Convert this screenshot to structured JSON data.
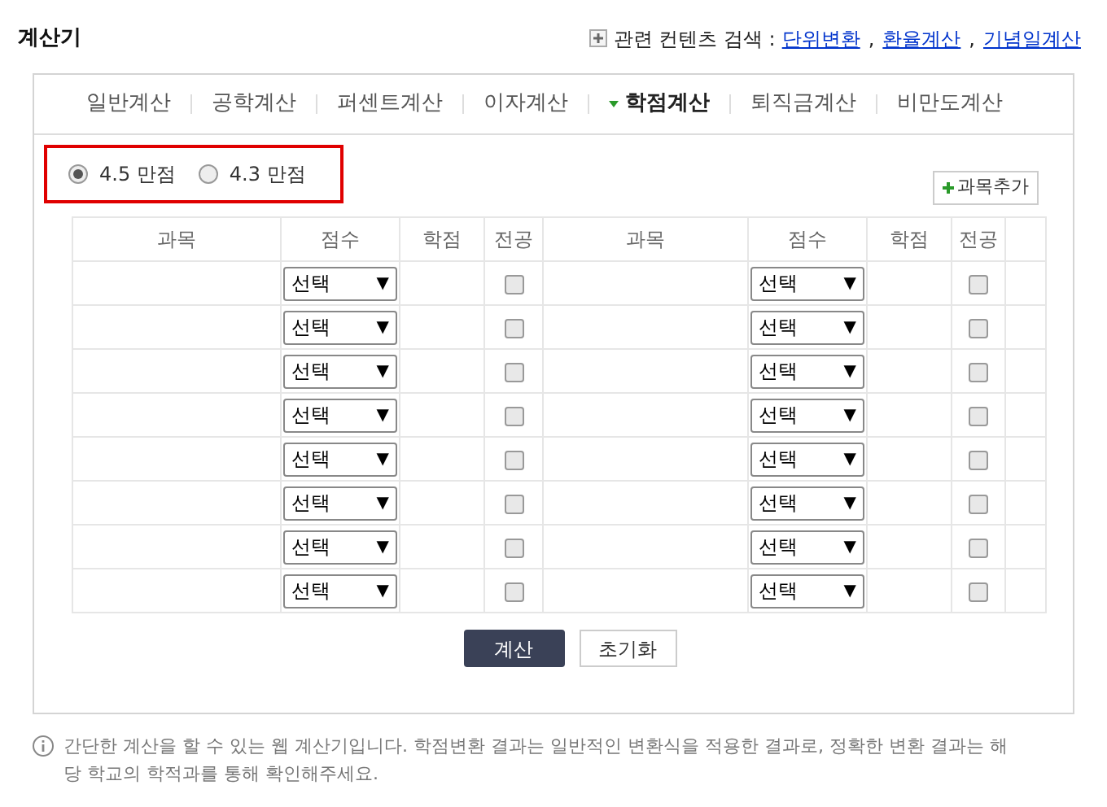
{
  "title": "계산기",
  "related": {
    "label": "관련 컨텐츠 검색 :",
    "links": [
      "단위변환",
      "환율계산",
      "기념일계산"
    ],
    "separator": ","
  },
  "tabs": [
    {
      "label": "일반계산",
      "selected": false
    },
    {
      "label": "공학계산",
      "selected": false
    },
    {
      "label": "퍼센트계산",
      "selected": false
    },
    {
      "label": "이자계산",
      "selected": false
    },
    {
      "label": "학점계산",
      "selected": true
    },
    {
      "label": "퇴직금계산",
      "selected": false
    },
    {
      "label": "비만도계산",
      "selected": false
    }
  ],
  "scale_options": [
    {
      "label": "4.5 만점",
      "selected": true
    },
    {
      "label": "4.3 만점",
      "selected": false
    }
  ],
  "add_subject_button": "과목추가",
  "table": {
    "columns": [
      "과목",
      "점수",
      "학점",
      "전공",
      "과목",
      "점수",
      "학점",
      "전공"
    ],
    "rows": [
      {
        "cells": [
          {
            "kind": "text",
            "text": ""
          },
          {
            "kind": "dropdown",
            "value": "선택"
          },
          {
            "kind": "text",
            "text": ""
          },
          {
            "kind": "checkbox",
            "checked": false
          },
          {
            "kind": "text",
            "text": ""
          },
          {
            "kind": "dropdown",
            "value": "선택"
          },
          {
            "kind": "text",
            "text": ""
          },
          {
            "kind": "checkbox",
            "checked": false
          }
        ]
      },
      {
        "cells": [
          {
            "kind": "text",
            "text": ""
          },
          {
            "kind": "dropdown",
            "value": "선택"
          },
          {
            "kind": "text",
            "text": ""
          },
          {
            "kind": "checkbox",
            "checked": false
          },
          {
            "kind": "text",
            "text": ""
          },
          {
            "kind": "dropdown",
            "value": "선택"
          },
          {
            "kind": "text",
            "text": ""
          },
          {
            "kind": "checkbox",
            "checked": false
          }
        ]
      },
      {
        "cells": [
          {
            "kind": "text",
            "text": ""
          },
          {
            "kind": "dropdown",
            "value": "선택"
          },
          {
            "kind": "text",
            "text": ""
          },
          {
            "kind": "checkbox",
            "checked": false
          },
          {
            "kind": "text",
            "text": ""
          },
          {
            "kind": "dropdown",
            "value": "선택"
          },
          {
            "kind": "text",
            "text": ""
          },
          {
            "kind": "checkbox",
            "checked": false
          }
        ]
      },
      {
        "cells": [
          {
            "kind": "text",
            "text": ""
          },
          {
            "kind": "dropdown",
            "value": "선택"
          },
          {
            "kind": "text",
            "text": ""
          },
          {
            "kind": "checkbox",
            "checked": false
          },
          {
            "kind": "text",
            "text": ""
          },
          {
            "kind": "dropdown",
            "value": "선택"
          },
          {
            "kind": "text",
            "text": ""
          },
          {
            "kind": "checkbox",
            "checked": false
          }
        ]
      },
      {
        "cells": [
          {
            "kind": "text",
            "text": ""
          },
          {
            "kind": "dropdown",
            "value": "선택"
          },
          {
            "kind": "text",
            "text": ""
          },
          {
            "kind": "checkbox",
            "checked": false
          },
          {
            "kind": "text",
            "text": ""
          },
          {
            "kind": "dropdown",
            "value": "선택"
          },
          {
            "kind": "text",
            "text": ""
          },
          {
            "kind": "checkbox",
            "checked": false
          }
        ]
      },
      {
        "cells": [
          {
            "kind": "text",
            "text": ""
          },
          {
            "kind": "dropdown",
            "value": "선택"
          },
          {
            "kind": "text",
            "text": ""
          },
          {
            "kind": "checkbox",
            "checked": false
          },
          {
            "kind": "text",
            "text": ""
          },
          {
            "kind": "dropdown",
            "value": "선택"
          },
          {
            "kind": "text",
            "text": ""
          },
          {
            "kind": "checkbox",
            "checked": false
          }
        ]
      },
      {
        "cells": [
          {
            "kind": "text",
            "text": ""
          },
          {
            "kind": "dropdown",
            "value": "선택"
          },
          {
            "kind": "text",
            "text": ""
          },
          {
            "kind": "checkbox",
            "checked": false
          },
          {
            "kind": "text",
            "text": ""
          },
          {
            "kind": "dropdown",
            "value": "선택"
          },
          {
            "kind": "text",
            "text": ""
          },
          {
            "kind": "checkbox",
            "checked": false
          }
        ]
      },
      {
        "cells": [
          {
            "kind": "text",
            "text": ""
          },
          {
            "kind": "dropdown",
            "value": "선택"
          },
          {
            "kind": "text",
            "text": ""
          },
          {
            "kind": "checkbox",
            "checked": false
          },
          {
            "kind": "text",
            "text": ""
          },
          {
            "kind": "dropdown",
            "value": "선택"
          },
          {
            "kind": "text",
            "text": ""
          },
          {
            "kind": "checkbox",
            "checked": false
          }
        ]
      }
    ]
  },
  "dropdown_arrow": "▼",
  "buttons": [
    "계산",
    "초기화"
  ],
  "note": "간단한 계산을 할 수 있는 웹 계산기입니다. 학점변환 결과는 일반적인 변환식을 적용한 결과로, 정확한 변환 결과는 해당 학교의 학적과를 통해 확인해주세요."
}
